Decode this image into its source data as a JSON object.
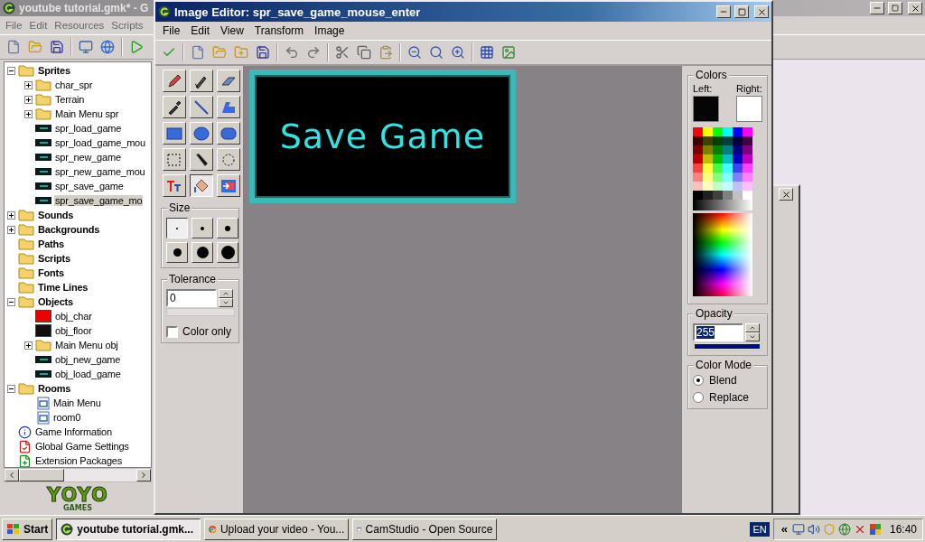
{
  "main_window": {
    "title": "youtube tutorial.gmk* - G",
    "menu": [
      "File",
      "Edit",
      "Resources",
      "Scripts"
    ],
    "tree": [
      {
        "label": "Sprites",
        "kind": "folder",
        "expanded": true,
        "selected": false,
        "children": [
          {
            "label": "char_spr",
            "kind": "folder",
            "expanded": false,
            "selected": false
          },
          {
            "label": "Terrain",
            "kind": "folder",
            "expanded": false,
            "selected": false
          },
          {
            "label": "Main Menu spr",
            "kind": "folder",
            "expanded": false,
            "selected": false
          },
          {
            "label": "spr_load_game",
            "kind": "sprite",
            "selected": false
          },
          {
            "label": "spr_load_game_mou",
            "kind": "sprite",
            "selected": false
          },
          {
            "label": "spr_new_game",
            "kind": "sprite",
            "selected": false
          },
          {
            "label": "spr_new_game_mou",
            "kind": "sprite",
            "selected": false
          },
          {
            "label": "spr_save_game",
            "kind": "sprite",
            "selected": false
          },
          {
            "label": "spr_save_game_mo",
            "kind": "sprite",
            "selected": true
          }
        ]
      },
      {
        "label": "Sounds",
        "kind": "folder",
        "expanded": false,
        "selected": false
      },
      {
        "label": "Backgrounds",
        "kind": "folder",
        "expanded": false,
        "selected": false
      },
      {
        "label": "Paths",
        "kind": "folder",
        "selected": false
      },
      {
        "label": "Scripts",
        "kind": "folder",
        "selected": false
      },
      {
        "label": "Fonts",
        "kind": "folder",
        "selected": false
      },
      {
        "label": "Time Lines",
        "kind": "folder",
        "selected": false
      },
      {
        "label": "Objects",
        "kind": "folder",
        "expanded": true,
        "selected": false,
        "children": [
          {
            "label": "obj_char",
            "kind": "object",
            "color": "#ee0000",
            "selected": false
          },
          {
            "label": "obj_floor",
            "kind": "object",
            "color": "#101010",
            "selected": false
          },
          {
            "label": "Main Menu obj",
            "kind": "folder",
            "expanded": false,
            "selected": false
          },
          {
            "label": "obj_new_game",
            "kind": "sprite",
            "selected": false
          },
          {
            "label": "obj_load_game",
            "kind": "sprite",
            "selected": false
          }
        ]
      },
      {
        "label": "Rooms",
        "kind": "folder",
        "expanded": true,
        "selected": false,
        "children": [
          {
            "label": "Main Menu",
            "kind": "room",
            "selected": false
          },
          {
            "label": "room0",
            "kind": "room",
            "selected": false
          }
        ]
      },
      {
        "label": "Game Information",
        "kind": "info",
        "selected": false
      },
      {
        "label": "Global Game Settings",
        "kind": "settings",
        "selected": false
      },
      {
        "label": "Extension Packages",
        "kind": "extension",
        "selected": false
      }
    ],
    "logo": {
      "top": "YOYO",
      "bottom": "GAMES"
    }
  },
  "image_editor": {
    "title": "Image Editor: spr_save_game_mouse_enter",
    "menu": [
      "File",
      "Edit",
      "View",
      "Transform",
      "Image"
    ],
    "tools": [
      {
        "selected": false
      },
      {
        "selected": false
      },
      {
        "selected": false
      },
      {
        "selected": false
      },
      {
        "selected": false
      },
      {
        "selected": false
      },
      {
        "selected": false
      },
      {
        "selected": false
      },
      {
        "selected": false
      },
      {
        "selected": false
      },
      {
        "selected": false
      },
      {
        "selected": false
      },
      {
        "selected": false
      },
      {
        "selected": true
      },
      {
        "selected": false
      }
    ],
    "size": {
      "label": "Size",
      "options": [
        {
          "selected": true
        },
        {
          "selected": false
        },
        {
          "selected": false
        },
        {
          "selected": false
        },
        {
          "selected": false
        },
        {
          "selected": false
        }
      ]
    },
    "tolerance": {
      "label": "Tolerance",
      "value": "0",
      "color_only": {
        "label": "Color only",
        "checked": false
      }
    },
    "sprite": {
      "text": "Save Game"
    },
    "colors": {
      "label": "Colors",
      "left": {
        "label": "Left:",
        "color": "#050505"
      },
      "right": {
        "label": "Right:",
        "color": "#ffffff"
      }
    },
    "opacity": {
      "label": "Opacity",
      "value": "255",
      "level": 1
    },
    "color_mode": {
      "label": "Color Mode",
      "options": [
        {
          "label": "Blend",
          "selected": true
        },
        {
          "label": "Replace",
          "selected": false
        }
      ]
    }
  },
  "taskbar": {
    "start": "Start",
    "tasks": [
      {
        "label": "youtube tutorial.gmk...",
        "kind": "gamemaker",
        "selected": true
      },
      {
        "label": "Upload your video - You...",
        "kind": "browser",
        "selected": false
      },
      {
        "label": "CamStudio - Open Source",
        "kind": "window",
        "selected": false
      }
    ],
    "language": "EN",
    "tray_toggle": "«",
    "clock": "16:40"
  }
}
